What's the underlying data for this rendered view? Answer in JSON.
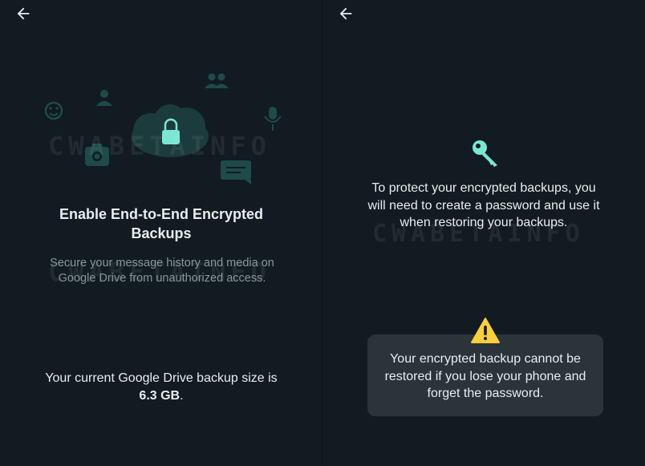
{
  "watermark": "CWABETAINFO",
  "left_screen": {
    "title": "Enable End-to-End Encrypted Backups",
    "description": "Secure your message history and media on Google Drive from unauthorized access.",
    "backup_size_prefix": "Your current Google Drive backup size is ",
    "backup_size_value": "6.3 GB",
    "backup_size_suffix": "."
  },
  "right_screen": {
    "info_text": "To protect your encrypted backups, you will need to create a password and use it when restoring your backups.",
    "warning_text": "Your encrypted backup cannot be restored if you lose your phone and forget the password."
  },
  "colors": {
    "background": "#111b21",
    "accent": "#7be6d3",
    "illustration": "#1f4a4a",
    "warning": "#f8cf3d"
  }
}
